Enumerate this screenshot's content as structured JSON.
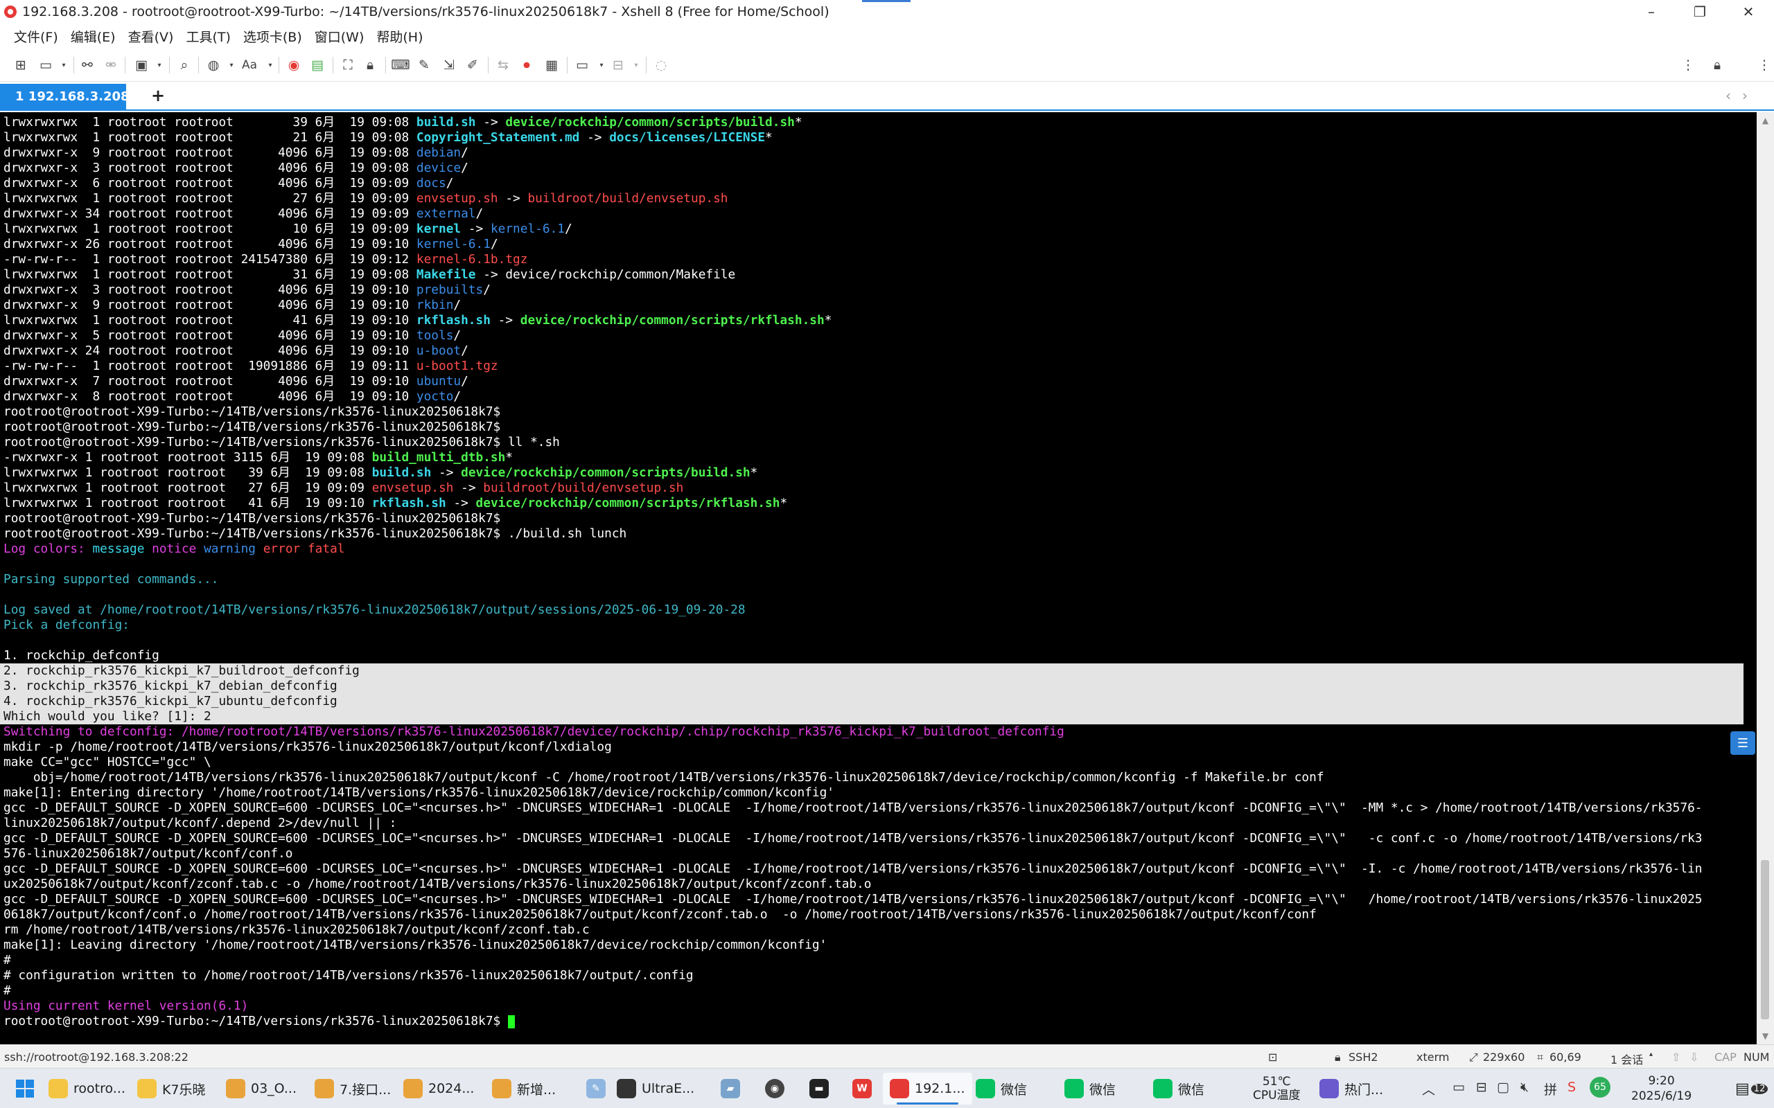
{
  "window": {
    "title": "192.168.3.208 - rootroot@rootroot-X99-Turbo: ~/14TB/versions/rk3576-linux20250618k7 - Xshell 8 (Free for Home/School)",
    "minimize": "–",
    "restore": "❐",
    "close": "✕"
  },
  "menu": [
    "文件(F)",
    "编辑(E)",
    "查看(V)",
    "工具(T)",
    "选项卡(B)",
    "窗口(W)",
    "帮助(H)"
  ],
  "tab": {
    "label": "1 192.168.3.208",
    "add": "+",
    "prev": "‹",
    "next": "›",
    "status_color": "#4caf50"
  },
  "terminal_lines": [
    [
      [
        "lrwxrwxrwx  1 rootroot rootroot        39 6月  19 09:08 ",
        ""
      ],
      [
        "build.sh",
        "c-cyan"
      ],
      [
        " -> ",
        ""
      ],
      [
        "device/rockchip/common/scripts/build.sh",
        "c-green"
      ],
      [
        "*",
        ""
      ]
    ],
    [
      [
        "lrwxrwxrwx  1 rootroot rootroot        21 6月  19 09:08 ",
        ""
      ],
      [
        "Copyright_Statement.md",
        "c-cyan"
      ],
      [
        " -> ",
        ""
      ],
      [
        "docs/licenses/LICENSE",
        "c-cyan"
      ],
      [
        "*",
        ""
      ]
    ],
    [
      [
        "drwxrwxr-x  9 rootroot rootroot      4096 6月  19 09:08 ",
        ""
      ],
      [
        "debian",
        "c-blue"
      ],
      [
        "/",
        ""
      ]
    ],
    [
      [
        "drwxrwxr-x  3 rootroot rootroot      4096 6月  19 09:08 ",
        ""
      ],
      [
        "device",
        "c-blue"
      ],
      [
        "/",
        ""
      ]
    ],
    [
      [
        "drwxrwxr-x  6 rootroot rootroot      4096 6月  19 09:09 ",
        ""
      ],
      [
        "docs",
        "c-blue"
      ],
      [
        "/",
        ""
      ]
    ],
    [
      [
        "lrwxrwxrwx  1 rootroot rootroot        27 6月  19 09:09 ",
        ""
      ],
      [
        "envsetup.sh",
        "c-red"
      ],
      [
        " -> ",
        ""
      ],
      [
        "buildroot/build/envsetup.sh",
        "c-red"
      ]
    ],
    [
      [
        "drwxrwxr-x 34 rootroot rootroot      4096 6月  19 09:09 ",
        ""
      ],
      [
        "external",
        "c-blue"
      ],
      [
        "/",
        ""
      ]
    ],
    [
      [
        "lrwxrwxrwx  1 rootroot rootroot        10 6月  19 09:09 ",
        ""
      ],
      [
        "kernel",
        "c-cyan"
      ],
      [
        " -> ",
        ""
      ],
      [
        "kernel-6.1",
        "c-blue"
      ],
      [
        "/",
        ""
      ]
    ],
    [
      [
        "drwxrwxr-x 26 rootroot rootroot      4096 6月  19 09:10 ",
        ""
      ],
      [
        "kernel-6.1",
        "c-blue"
      ],
      [
        "/",
        ""
      ]
    ],
    [
      [
        "-rw-rw-r--  1 rootroot rootroot 241547380 6月  19 09:12 ",
        ""
      ],
      [
        "kernel-6.1b.tgz",
        "c-red"
      ]
    ],
    [
      [
        "lrwxrwxrwx  1 rootroot rootroot        31 6月  19 09:08 ",
        ""
      ],
      [
        "Makefile",
        "c-cyan"
      ],
      [
        " -> device/rockchip/common/Makefile",
        ""
      ]
    ],
    [
      [
        "drwxrwxr-x  3 rootroot rootroot      4096 6月  19 09:10 ",
        ""
      ],
      [
        "prebuilts",
        "c-blue"
      ],
      [
        "/",
        ""
      ]
    ],
    [
      [
        "drwxrwxr-x  9 rootroot rootroot      4096 6月  19 09:10 ",
        ""
      ],
      [
        "rkbin",
        "c-blue"
      ],
      [
        "/",
        ""
      ]
    ],
    [
      [
        "lrwxrwxrwx  1 rootroot rootroot        41 6月  19 09:10 ",
        ""
      ],
      [
        "rkflash.sh",
        "c-cyan"
      ],
      [
        " -> ",
        ""
      ],
      [
        "device/rockchip/common/scripts/rkflash.sh",
        "c-green"
      ],
      [
        "*",
        ""
      ]
    ],
    [
      [
        "drwxrwxr-x  5 rootroot rootroot      4096 6月  19 09:10 ",
        ""
      ],
      [
        "tools",
        "c-blue"
      ],
      [
        "/",
        ""
      ]
    ],
    [
      [
        "drwxrwxr-x 24 rootroot rootroot      4096 6月  19 09:10 ",
        ""
      ],
      [
        "u-boot",
        "c-blue"
      ],
      [
        "/",
        ""
      ]
    ],
    [
      [
        "-rw-rw-r--  1 rootroot rootroot  19091886 6月  19 09:11 ",
        ""
      ],
      [
        "u-boot1.tgz",
        "c-red"
      ]
    ],
    [
      [
        "drwxrwxr-x  7 rootroot rootroot      4096 6月  19 09:10 ",
        ""
      ],
      [
        "ubuntu",
        "c-blue"
      ],
      [
        "/",
        ""
      ]
    ],
    [
      [
        "drwxrwxr-x  8 rootroot rootroot      4096 6月  19 09:10 ",
        ""
      ],
      [
        "yocto",
        "c-blue"
      ],
      [
        "/",
        ""
      ]
    ],
    [
      [
        "rootroot@rootroot-X99-Turbo:~/14TB/versions/rk3576-linux20250618k7$ ",
        ""
      ]
    ],
    [
      [
        "rootroot@rootroot-X99-Turbo:~/14TB/versions/rk3576-linux20250618k7$ ",
        ""
      ]
    ],
    [
      [
        "rootroot@rootroot-X99-Turbo:~/14TB/versions/rk3576-linux20250618k7$ ll *.sh",
        ""
      ]
    ],
    [
      [
        "-rwxrwxr-x 1 rootroot rootroot 3115 6月  19 09:08 ",
        ""
      ],
      [
        "build_multi_dtb.sh",
        "c-green"
      ],
      [
        "*",
        ""
      ]
    ],
    [
      [
        "lrwxrwxrwx 1 rootroot rootroot   39 6月  19 09:08 ",
        ""
      ],
      [
        "build.sh",
        "c-cyan"
      ],
      [
        " -> ",
        ""
      ],
      [
        "device/rockchip/common/scripts/build.sh",
        "c-green"
      ],
      [
        "*",
        ""
      ]
    ],
    [
      [
        "lrwxrwxrwx 1 rootroot rootroot   27 6月  19 09:09 ",
        ""
      ],
      [
        "envsetup.sh",
        "c-red"
      ],
      [
        " -> ",
        ""
      ],
      [
        "buildroot/build/envsetup.sh",
        "c-red"
      ]
    ],
    [
      [
        "lrwxrwxrwx 1 rootroot rootroot   41 6月  19 09:10 ",
        ""
      ],
      [
        "rkflash.sh",
        "c-cyan"
      ],
      [
        " -> ",
        ""
      ],
      [
        "device/rockchip/common/scripts/rkflash.sh",
        "c-green"
      ],
      [
        "*",
        ""
      ]
    ],
    [
      [
        "rootroot@rootroot-X99-Turbo:~/14TB/versions/rk3576-linux20250618k7$ ",
        ""
      ]
    ],
    [
      [
        "rootroot@rootroot-X99-Turbo:~/14TB/versions/rk3576-linux20250618k7$ ./build.sh lunch",
        ""
      ]
    ],
    [
      [
        "Log colors: ",
        "c-magenta"
      ],
      [
        "message ",
        "c-cyanl"
      ],
      [
        "notice ",
        "c-magenta"
      ],
      [
        "warning ",
        "c-blue"
      ],
      [
        "error ",
        "c-red"
      ],
      [
        "fatal",
        "c-red"
      ]
    ],
    [
      [
        "",
        ""
      ]
    ],
    [
      [
        "Parsing supported commands...",
        "c-teal"
      ]
    ],
    [
      [
        "",
        ""
      ]
    ],
    [
      [
        "Log saved at /home/rootroot/14TB/versions/rk3576-linux20250618k7/output/sessions/2025-06-19_09-20-28",
        "c-teal"
      ]
    ],
    [
      [
        "Pick a defconfig:",
        "c-teal"
      ]
    ],
    [
      [
        "",
        ""
      ]
    ],
    [
      [
        "1. rockchip_defconfig",
        ""
      ]
    ],
    [
      [
        "2. rockchip_rk3576_kickpi_k7_buildroot_defconfig",
        "sel"
      ]
    ],
    [
      [
        "3. rockchip_rk3576_kickpi_k7_debian_defconfig",
        "sel"
      ]
    ],
    [
      [
        "4. rockchip_rk3576_kickpi_k7_ubuntu_defconfig",
        "sel"
      ]
    ],
    [
      [
        "Which would you like? [1]: 2",
        "sel"
      ]
    ],
    [
      [
        "Switching to defconfig: /home/rootroot/14TB/versions/rk3576-linux20250618k7/device/rockchip/.chip/rockchip_rk3576_kickpi_k7_buildroot_defconfig",
        "c-magenta"
      ]
    ],
    [
      [
        "mkdir -p /home/rootroot/14TB/versions/rk3576-linux20250618k7/output/kconf/lxdialog",
        ""
      ]
    ],
    [
      [
        "make CC=\"gcc\" HOSTCC=\"gcc\" \\",
        ""
      ]
    ],
    [
      [
        "    obj=/home/rootroot/14TB/versions/rk3576-linux20250618k7/output/kconf -C /home/rootroot/14TB/versions/rk3576-linux20250618k7/device/rockchip/common/kconfig -f Makefile.br conf",
        ""
      ]
    ],
    [
      [
        "make[1]: Entering directory '/home/rootroot/14TB/versions/rk3576-linux20250618k7/device/rockchip/common/kconfig'",
        ""
      ]
    ],
    [
      [
        "gcc -D_DEFAULT_SOURCE -D_XOPEN_SOURCE=600 -DCURSES_LOC=\"<ncurses.h>\" -DNCURSES_WIDECHAR=1 -DLOCALE  -I/home/rootroot/14TB/versions/rk3576-linux20250618k7/output/kconf -DCONFIG_=\\\"\\\"  -MM *.c > /home/rootroot/14TB/versions/rk3576-",
        ""
      ]
    ],
    [
      [
        "linux20250618k7/output/kconf/.depend 2>/dev/null || :",
        ""
      ]
    ],
    [
      [
        "gcc -D_DEFAULT_SOURCE -D_XOPEN_SOURCE=600 -DCURSES_LOC=\"<ncurses.h>\" -DNCURSES_WIDECHAR=1 -DLOCALE  -I/home/rootroot/14TB/versions/rk3576-linux20250618k7/output/kconf -DCONFIG_=\\\"\\\"   -c conf.c -o /home/rootroot/14TB/versions/rk3",
        ""
      ]
    ],
    [
      [
        "576-linux20250618k7/output/kconf/conf.o",
        ""
      ]
    ],
    [
      [
        "gcc -D_DEFAULT_SOURCE -D_XOPEN_SOURCE=600 -DCURSES_LOC=\"<ncurses.h>\" -DNCURSES_WIDECHAR=1 -DLOCALE  -I/home/rootroot/14TB/versions/rk3576-linux20250618k7/output/kconf -DCONFIG_=\\\"\\\"  -I. -c /home/rootroot/14TB/versions/rk3576-lin",
        ""
      ]
    ],
    [
      [
        "ux20250618k7/output/kconf/zconf.tab.c -o /home/rootroot/14TB/versions/rk3576-linux20250618k7/output/kconf/zconf.tab.o",
        ""
      ]
    ],
    [
      [
        "gcc -D_DEFAULT_SOURCE -D_XOPEN_SOURCE=600 -DCURSES_LOC=\"<ncurses.h>\" -DNCURSES_WIDECHAR=1 -DLOCALE  -I/home/rootroot/14TB/versions/rk3576-linux20250618k7/output/kconf -DCONFIG_=\\\"\\\"   /home/rootroot/14TB/versions/rk3576-linux2025",
        ""
      ]
    ],
    [
      [
        "0618k7/output/kconf/conf.o /home/rootroot/14TB/versions/rk3576-linux20250618k7/output/kconf/zconf.tab.o  -o /home/rootroot/14TB/versions/rk3576-linux20250618k7/output/kconf/conf",
        ""
      ]
    ],
    [
      [
        "rm /home/rootroot/14TB/versions/rk3576-linux20250618k7/output/kconf/zconf.tab.c",
        ""
      ]
    ],
    [
      [
        "make[1]: Leaving directory '/home/rootroot/14TB/versions/rk3576-linux20250618k7/device/rockchip/common/kconfig'",
        ""
      ]
    ],
    [
      [
        "#",
        ""
      ]
    ],
    [
      [
        "# configuration written to /home/rootroot/14TB/versions/rk3576-linux20250618k7/output/.config",
        ""
      ]
    ],
    [
      [
        "#",
        ""
      ]
    ],
    [
      [
        "Using current kernel version(6.1)",
        "c-magenta"
      ]
    ],
    [
      [
        "rootroot@rootroot-X99-Turbo:~/14TB/versions/rk3576-linux20250618k7$ ",
        ""
      ]
    ]
  ],
  "status": {
    "connection": "ssh://rootroot@192.168.3.208:22",
    "protocol": "SSH2",
    "term": "xterm",
    "size": "229x60",
    "cursor": "60,69",
    "sessions": "1 会话",
    "cap": "CAP",
    "num": "NUM"
  },
  "taskbar": {
    "items": [
      {
        "label": "rootro...",
        "color": "#f4c542"
      },
      {
        "label": "K7乐晓",
        "color": "#f4c542"
      },
      {
        "label": "03_O...",
        "color": "#e8a33b"
      },
      {
        "label": "7.接口...",
        "color": "#e8a33b"
      },
      {
        "label": "2024...",
        "color": "#e8a33b"
      },
      {
        "label": "新增...",
        "color": "#e8a33b"
      },
      {
        "label": "UltraE...",
        "color": "#333333"
      },
      {
        "label": "192.1...",
        "color": "#e53935"
      },
      {
        "label": "微信",
        "color": "#07c160"
      },
      {
        "label": "微信",
        "color": "#07c160"
      },
      {
        "label": "微信",
        "color": "#07c160"
      },
      {
        "label": "热门...",
        "color": "#6a5acd"
      }
    ],
    "temp": "51℃",
    "temp_label": "CPU温度",
    "time": "9:20",
    "date": "2025/6/19",
    "notifications": "12",
    "badge": "65"
  },
  "colors": {
    "accent": "#1e88e5",
    "terminal_bg": "#000000",
    "cursor": "#23ff23"
  }
}
